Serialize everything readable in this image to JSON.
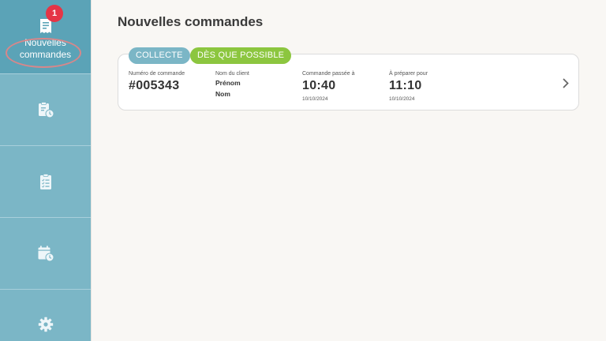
{
  "sidebar": {
    "items": [
      {
        "label": "Nouvelles\ncommandes",
        "icon": "receipt-icon",
        "badge": "1",
        "active": true
      },
      {
        "label": "",
        "icon": "clipboard-clock-icon"
      },
      {
        "label": "",
        "icon": "clipboard-checklist-icon"
      },
      {
        "label": "",
        "icon": "calendar-clock-icon"
      },
      {
        "label": "",
        "icon": "gear-icon"
      }
    ]
  },
  "header": {
    "title": "Nouvelles commandes"
  },
  "order": {
    "tags": {
      "mode": "COLLECTE",
      "timing": "DÈS QUE POSSIBLE"
    },
    "number_label": "Numéro de commande",
    "number": "#005343",
    "client_label": "Nom du client",
    "client_first": "Prénom",
    "client_last": "Nom",
    "placed_label": "Commande passée à",
    "placed_time": "10:40",
    "placed_date": "10/10/2024",
    "prepare_label": "À préparer pour",
    "prepare_time": "11:10",
    "prepare_date": "10/10/2024"
  },
  "colors": {
    "sidebar": "#7bb6c6",
    "sidebar_active": "#5ba3b7",
    "badge": "#e53546",
    "tag_collect": "#7bb6c6",
    "tag_asap": "#8cc63f"
  }
}
